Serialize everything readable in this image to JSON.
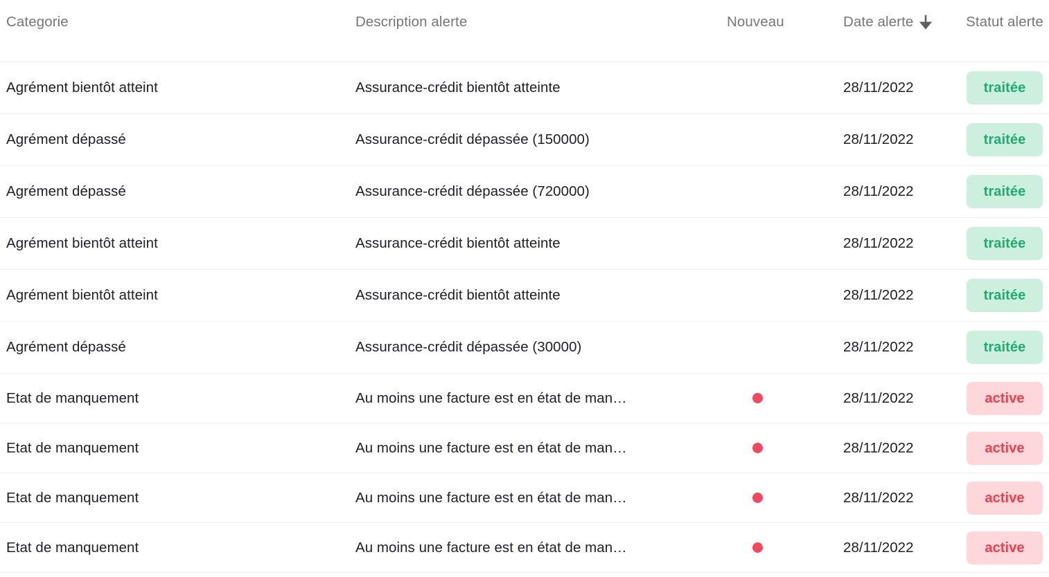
{
  "table": {
    "columns": [
      {
        "key": "categorie",
        "label": "Categorie",
        "sorted": false
      },
      {
        "key": "description",
        "label": "Description alerte",
        "sorted": false
      },
      {
        "key": "nouveau",
        "label": "Nouveau",
        "sorted": false
      },
      {
        "key": "date",
        "label": "Date alerte",
        "sorted": true,
        "sort_icon": "arrow-down-icon",
        "sort_direction": "desc"
      },
      {
        "key": "statut",
        "label": "Statut alerte",
        "sorted": false
      }
    ],
    "rows": [
      {
        "categorie": "Agrément bientôt atteint",
        "description": "Assurance-crédit bientôt atteinte",
        "nouveau": false,
        "date": "28/11/2022",
        "statut": "traitée",
        "statut_kind": "traitee"
      },
      {
        "categorie": "Agrément dépassé",
        "description": "Assurance-crédit dépassée (150000)",
        "nouveau": false,
        "date": "28/11/2022",
        "statut": "traitée",
        "statut_kind": "traitee"
      },
      {
        "categorie": "Agrément dépassé",
        "description": "Assurance-crédit dépassée (720000)",
        "nouveau": false,
        "date": "28/11/2022",
        "statut": "traitée",
        "statut_kind": "traitee"
      },
      {
        "categorie": "Agrément bientôt atteint",
        "description": "Assurance-crédit bientôt atteinte",
        "nouveau": false,
        "date": "28/11/2022",
        "statut": "traitée",
        "statut_kind": "traitee"
      },
      {
        "categorie": "Agrément bientôt atteint",
        "description": "Assurance-crédit bientôt atteinte",
        "nouveau": false,
        "date": "28/11/2022",
        "statut": "traitée",
        "statut_kind": "traitee"
      },
      {
        "categorie": "Agrément dépassé",
        "description": "Assurance-crédit dépassée (30000)",
        "nouveau": false,
        "date": "28/11/2022",
        "statut": "traitée",
        "statut_kind": "traitee"
      },
      {
        "categorie": "Etat de manquement",
        "description": "Au moins une facture est en état de man…",
        "nouveau": true,
        "date": "28/11/2022",
        "statut": "active",
        "statut_kind": "active"
      },
      {
        "categorie": "Etat de manquement",
        "description": "Au moins une facture est en état de man…",
        "nouveau": true,
        "date": "28/11/2022",
        "statut": "active",
        "statut_kind": "active"
      },
      {
        "categorie": "Etat de manquement",
        "description": "Au moins une facture est en état de man…",
        "nouveau": true,
        "date": "28/11/2022",
        "statut": "active",
        "statut_kind": "active"
      },
      {
        "categorie": "Etat de manquement",
        "description": "Au moins une facture est en état de man…",
        "nouveau": true,
        "date": "28/11/2022",
        "statut": "active",
        "statut_kind": "active"
      }
    ]
  },
  "colors": {
    "header_text": "#76767a",
    "body_text": "#20202a",
    "row_divider": "#efeff1",
    "header_divider": "#ececee",
    "background": "#ffffff",
    "new_dot": "#f4485c",
    "badge_traitee_bg": "#ccf0dd",
    "badge_traitee_text": "#1dad6f",
    "badge_active_bg": "#fdd7d9",
    "badge_active_text": "#f43d4e",
    "sort_arrow": "#5f5f63"
  }
}
